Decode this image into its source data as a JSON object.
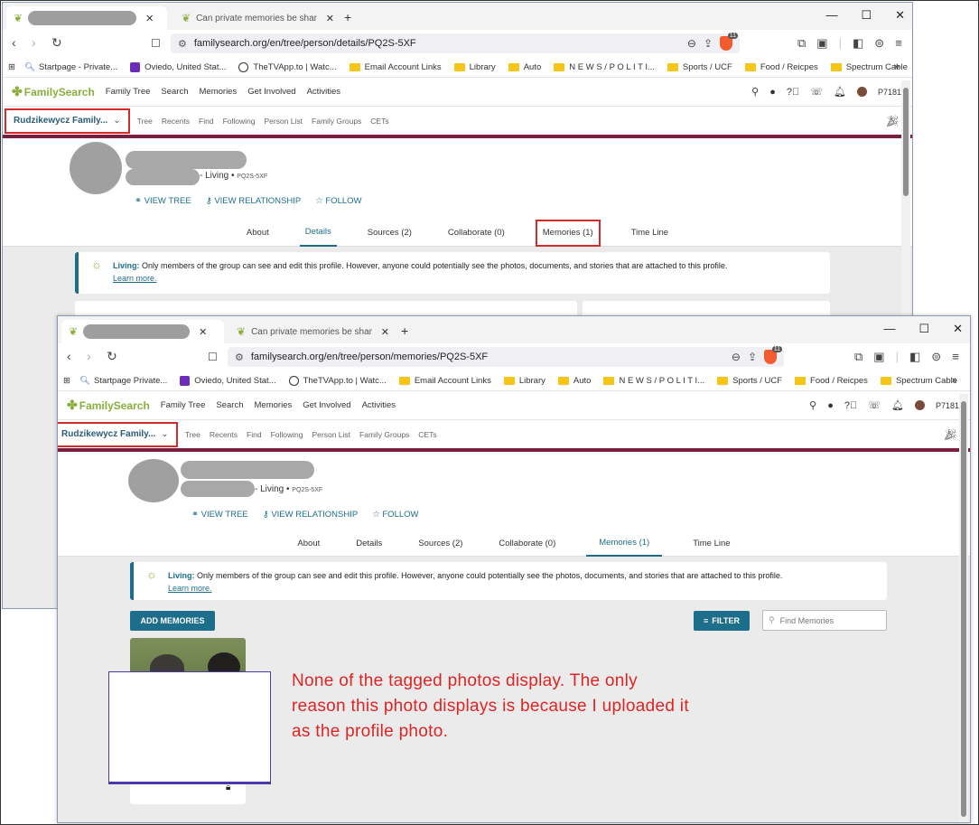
{
  "browser_back": {
    "tab_title": "Can private memories be shared with",
    "url": "familysearch.org/en/tree/person/details/PQ2S-5XF"
  },
  "browser_front": {
    "tab_title": "Can private memories be shared with",
    "url": "familysearch.org/en/tree/person/memories/PQ2S-5XF"
  },
  "window_controls": {
    "minimize": "—",
    "maximize": "☐",
    "close": "✕"
  },
  "bookmarks": [
    "Startpage - Private...",
    "Oviedo, United Stat...",
    "TheTVApp.to | Watc...",
    "Email Account Links",
    "Library",
    "Auto",
    "N E W S / P O L I T I...",
    "Sports / UCF",
    "Food / Reicpes",
    "Spectrum Cable"
  ],
  "bookmarks_front": [
    "Startpage  Private...",
    "Oviedo, United Stat...",
    "TheTVApp.to | Watc...",
    "Email Account Links",
    "Library",
    "Auto",
    "N E W S / P O L I T I...",
    "Sports / UCF",
    "Food / Reicpes",
    "Spectrum Cable"
  ],
  "bookmarks_more": "»",
  "fs": {
    "logo": "FamilySearch",
    "nav": [
      "Family Tree",
      "Search",
      "Memories",
      "Get Involved",
      "Activities"
    ],
    "nav_front": [
      "Family Tree",
      "Search",
      "Memories",
      "Get Involved",
      "Activities"
    ],
    "user_id": "P7181",
    "group_selector": "Rudzikewycz Family...",
    "subnav": [
      "Tree",
      "Recents",
      "Find",
      "Following",
      "Person List",
      "Family Groups",
      "CETs"
    ]
  },
  "person": {
    "living": "- Living •",
    "pid": "PQ2S-5XF",
    "actions": [
      "VIEW TREE",
      "VIEW RELATIONSHIP",
      "FOLLOW"
    ]
  },
  "person_tabs": [
    "About",
    "Details",
    "Sources (2)",
    "Collaborate (0)",
    "Memories (1)",
    "Time Line"
  ],
  "living_notice": {
    "label": "Living:",
    "text": "Only members of the group can see and edit this profile. However, anyone could potentially see the photos, documents, and stories that are attached to this profile.",
    "link": "Learn more."
  },
  "memories_page": {
    "add_button": "ADD MEMORIES",
    "filter_button": "FILTER",
    "find_placeholder": "Find Memories"
  },
  "annotation": {
    "line1": "None of the tagged photos display. The only",
    "line2": "reason this photo displays is because I uploaded it",
    "line3": "as the profile photo."
  },
  "colors": {
    "accent": "#1d6e8a",
    "maroon": "#7a1f3d",
    "highlight_red": "#d32b2b",
    "annotation_red": "#e02424",
    "logo_green": "#8bae3c"
  }
}
